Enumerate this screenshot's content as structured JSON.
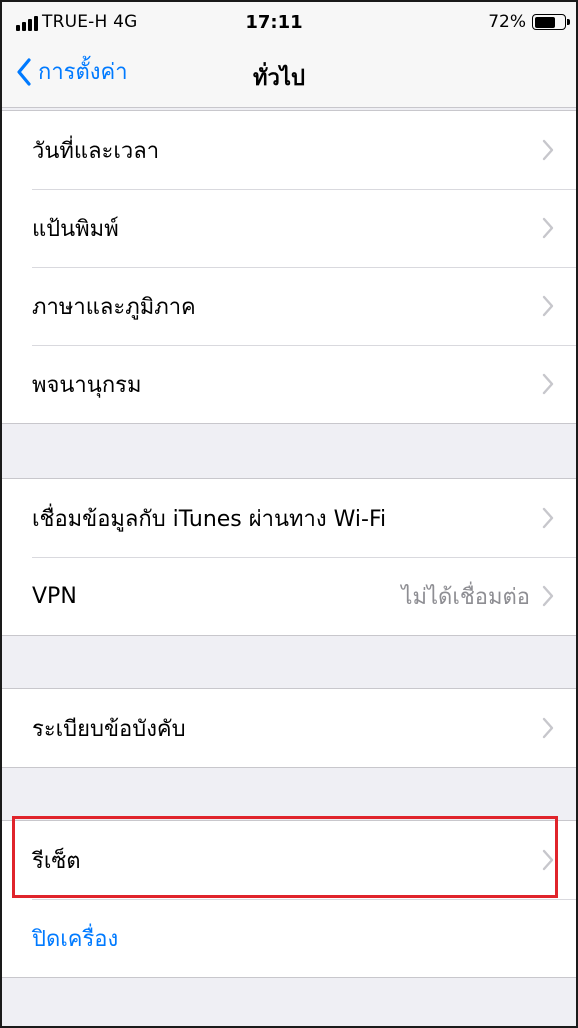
{
  "status_bar": {
    "carrier": "TRUE-H  4G",
    "time": "17:11",
    "battery_percent": "72%",
    "battery_level": 0.72
  },
  "nav": {
    "back_label": "การตั้งค่า",
    "title": "ทั่วไป"
  },
  "groups": [
    {
      "rows": [
        {
          "label": "วันที่และเวลา",
          "detail": ""
        },
        {
          "label": "แป้นพิมพ์",
          "detail": ""
        },
        {
          "label": "ภาษาและภูมิภาค",
          "detail": ""
        },
        {
          "label": "พจนานุกรม",
          "detail": ""
        }
      ]
    },
    {
      "rows": [
        {
          "label": "เชื่อมข้อมูลกับ iTunes ผ่านทาง Wi-Fi",
          "detail": ""
        },
        {
          "label": "VPN",
          "detail": "ไม่ได้เชื่อมต่อ"
        }
      ]
    },
    {
      "rows": [
        {
          "label": "ระเบียบข้อบังคับ",
          "detail": ""
        }
      ]
    },
    {
      "rows": [
        {
          "label": "รีเซ็ต",
          "detail": ""
        },
        {
          "label": "ปิดเครื่อง",
          "detail": ""
        }
      ]
    }
  ],
  "colors": {
    "accent": "#007aff",
    "highlight": "#e0242b",
    "background": "#efeff4"
  }
}
